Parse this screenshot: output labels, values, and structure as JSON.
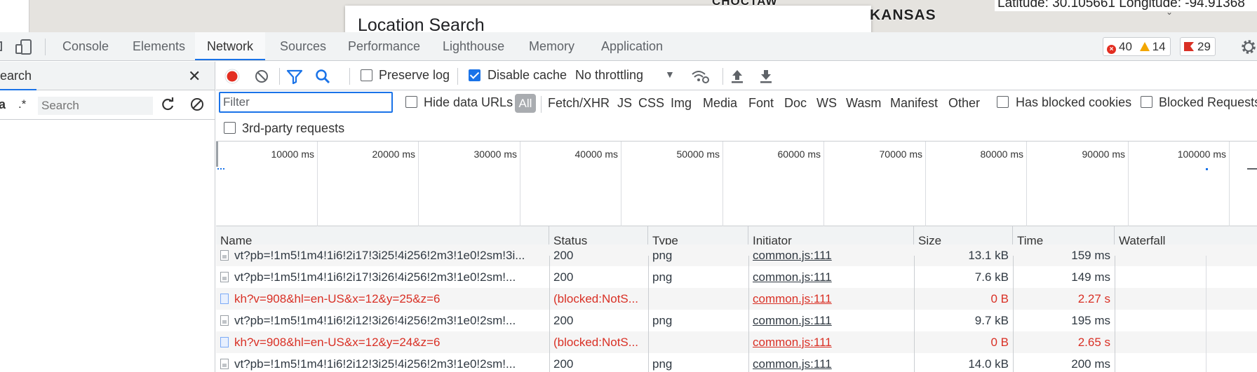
{
  "page": {
    "card_title": "Location Search",
    "map_label_1": "CHOCTAW",
    "map_label_2": "KANSAS",
    "coords": "Latitude: 30.105661 Longitude: -94.91368"
  },
  "tabs": [
    {
      "label": "Console"
    },
    {
      "label": "Elements"
    },
    {
      "label": "Network",
      "active": true
    },
    {
      "label": "Sources"
    },
    {
      "label": "Performance"
    },
    {
      "label": "Lighthouse"
    },
    {
      "label": "Memory"
    },
    {
      "label": "Application"
    }
  ],
  "counters": {
    "errors": "40",
    "warnings": "14",
    "issues": "29"
  },
  "search_panel": {
    "title": "earch",
    "case_label": "a",
    "regex_label": ".*",
    "placeholder": "Search"
  },
  "toolbar": {
    "preserve_log": "Preserve log",
    "preserve_checked": false,
    "disable_cache": "Disable cache",
    "disable_checked": true,
    "throttling": "No throttling"
  },
  "filter": {
    "placeholder": "Filter",
    "hide_data_urls": "Hide data URLs",
    "types": [
      "All",
      "Fetch/XHR",
      "JS",
      "CSS",
      "Img",
      "Media",
      "Font",
      "Doc",
      "WS",
      "Wasm",
      "Manifest",
      "Other"
    ],
    "has_blocked_cookies": "Has blocked cookies",
    "blocked_requests": "Blocked Requests",
    "third_party": "3rd-party requests"
  },
  "overview": {
    "ticks": [
      "10000 ms",
      "20000 ms",
      "30000 ms",
      "40000 ms",
      "50000 ms",
      "60000 ms",
      "70000 ms",
      "80000 ms",
      "90000 ms",
      "100000 ms"
    ]
  },
  "table": {
    "columns": [
      "Name",
      "Status",
      "Type",
      "Initiator",
      "Size",
      "Time",
      "Waterfall"
    ],
    "rows": [
      {
        "name": "vt?pb=!1m5!1m4!1i6!2i17!3i25!4i256!2m3!1e0!2sm!3i...",
        "status": "200",
        "type": "png",
        "initiator": "common.js:111",
        "size": "13.1 kB",
        "time": "159 ms",
        "error": false,
        "icon": "img"
      },
      {
        "name": "vt?pb=!1m5!1m4!1i6!2i17!3i26!4i256!2m3!1e0!2sm!...",
        "status": "200",
        "type": "png",
        "initiator": "common.js:111",
        "size": "7.6 kB",
        "time": "149 ms",
        "error": false,
        "icon": "img"
      },
      {
        "name": "kh?v=908&hl=en-US&x=12&y=25&z=6",
        "status": "(blocked:NotS...",
        "type": "",
        "initiator": "common.js:111",
        "size": "0 B",
        "time": "2.27 s",
        "error": true,
        "icon": "doc"
      },
      {
        "name": "vt?pb=!1m5!1m4!1i6!2i12!3i26!4i256!2m3!1e0!2sm!...",
        "status": "200",
        "type": "png",
        "initiator": "common.js:111",
        "size": "9.7 kB",
        "time": "195 ms",
        "error": false,
        "icon": "img"
      },
      {
        "name": "kh?v=908&hl=en-US&x=12&y=24&z=6",
        "status": "(blocked:NotS...",
        "type": "",
        "initiator": "common.js:111",
        "size": "0 B",
        "time": "2.65 s",
        "error": true,
        "icon": "doc"
      },
      {
        "name": "vt?pb=!1m5!1m4!1i6!2i12!3i25!4i256!2m3!1e0!2sm!...",
        "status": "200",
        "type": "png",
        "initiator": "common.js:111",
        "size": "14.0 kB",
        "time": "200 ms",
        "error": false,
        "icon": "img"
      }
    ]
  },
  "colors": {
    "accent": "#1a73e8",
    "error": "#d93025",
    "warning": "#f2a600",
    "record": "#e32e21"
  }
}
